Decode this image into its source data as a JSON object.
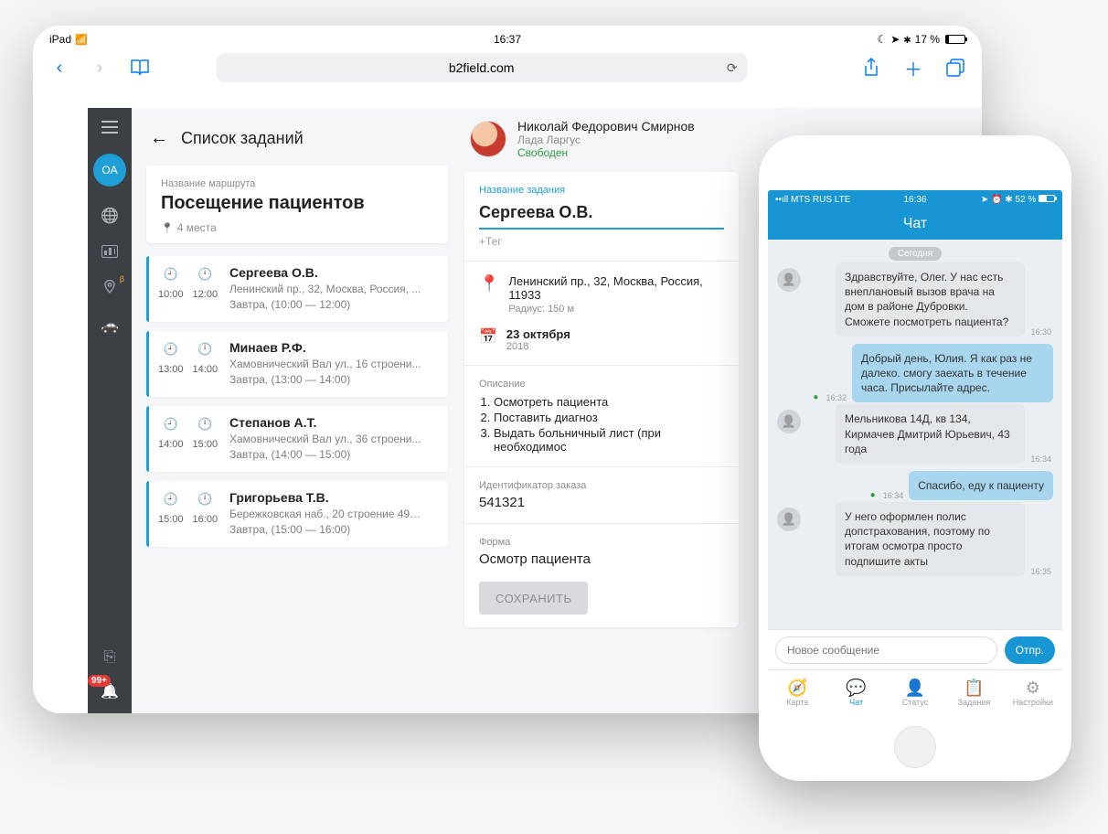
{
  "tablet": {
    "status": {
      "device": "iPad",
      "time": "16:37",
      "battery_pct": "17 %"
    },
    "safari": {
      "url": "b2field.com"
    },
    "sidebar": {
      "avatar": "OA",
      "beta": "β",
      "badge": "99+"
    },
    "list": {
      "back_title": "Список заданий",
      "route_label": "Название маршрута",
      "route_name": "Посещение пациентов",
      "places": "4 места",
      "visits": [
        {
          "from": "10:00",
          "to": "12:00",
          "name": "Сергеева О.В.",
          "addr": "Ленинский пр., 32, Москва, Россия, ...",
          "when": "Завтра, (10:00 — 12:00)"
        },
        {
          "from": "13:00",
          "to": "14:00",
          "name": "Минаев Р.Ф.",
          "addr": "Хамовнический Вал ул., 16 строени...",
          "when": "Завтра, (13:00 — 14:00)"
        },
        {
          "from": "14:00",
          "to": "15:00",
          "name": "Степанов А.Т.",
          "addr": "Хамовнический Вал ул., 36 строени...",
          "when": "Завтра, (14:00 — 15:00)"
        },
        {
          "from": "15:00",
          "to": "16:00",
          "name": "Григорьева Т.В.",
          "addr": "Бережковская наб., 20 строение 49, ...",
          "when": "Завтра, (15:00 — 16:00)"
        }
      ]
    },
    "assignee": {
      "name": "Николай Федорович Смирнов",
      "vehicle": "Лада Ларгус",
      "status": "Свободен"
    },
    "task": {
      "name_label": "Название задания",
      "name_value": "Сергеева О.В.",
      "tag": "+Тег",
      "address": "Ленинский пр., 32, Москва, Россия, 11933",
      "radius": "Радиус: 150 м",
      "date": "23 октября",
      "year": "2018",
      "desc_label": "Описание",
      "desc": [
        "Осмотреть пациента",
        "Поставить диагноз",
        "Выдать больничный лист (при необходимос"
      ],
      "order_label": "Идентификатор заказа",
      "order_id": "541321",
      "form_label": "Форма",
      "form_value": "Осмотр пациента",
      "save": "СОХРАНИТЬ"
    }
  },
  "phone": {
    "status": {
      "carrier": "MTS RUS  LTE",
      "time": "16:36",
      "battery_pct": "52 %",
      "signal": "••ıll"
    },
    "header": "Чат",
    "day": "Сегодня",
    "messages": [
      {
        "dir": "in",
        "text": "Здравствуйте, Олег. У нас есть внеплановый вызов врача на дом в районе Дубровки. Сможете посмотреть пациента?",
        "time": "16:30"
      },
      {
        "dir": "out",
        "text": "Добрый день, Юлия. Я как раз не далеко. смогу заехать в течение часа. Присылайте адрес.",
        "time": "16:32",
        "sent": true
      },
      {
        "dir": "in",
        "text": "Мельникова 14Д, кв 134, Кирмачев Дмитрий Юрьевич, 43 года",
        "time": "16:34"
      },
      {
        "dir": "out",
        "text": "Спасибо, еду к пациенту",
        "time": "16:34",
        "sent": true
      },
      {
        "dir": "in",
        "text": "У него оформлен полис допстрахования, поэтому по итогам осмотра просто подпишите акты",
        "time": "16:35"
      }
    ],
    "composer": {
      "placeholder": "Новое сообщение",
      "send": "Отпр."
    },
    "tabs": [
      {
        "label": "Карта",
        "icon": "🧭"
      },
      {
        "label": "Чат",
        "icon": "💬",
        "active": true
      },
      {
        "label": "Статус",
        "icon": "👤"
      },
      {
        "label": "Задания",
        "icon": "📋"
      },
      {
        "label": "Настройки",
        "icon": "⚙"
      }
    ]
  }
}
